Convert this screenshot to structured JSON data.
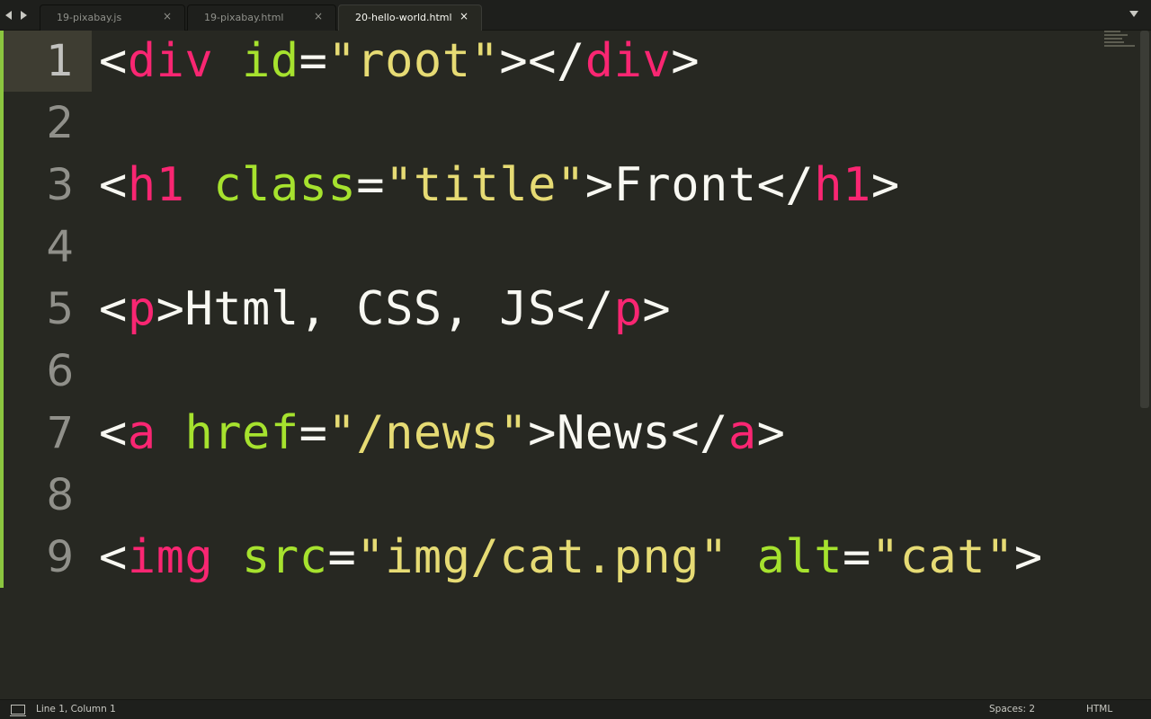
{
  "tabs": [
    {
      "label": "19-pixabay.js",
      "close": "×",
      "active": false
    },
    {
      "label": "19-pixabay.html",
      "close": "×",
      "active": false
    },
    {
      "label": "20-hello-world.html",
      "close": "×",
      "active": true
    }
  ],
  "line_numbers": [
    "1",
    "2",
    "3",
    "4",
    "5",
    "6",
    "7",
    "8",
    "9"
  ],
  "code": {
    "line1": {
      "open": "<",
      "tag": "div",
      "sp": " ",
      "attr": "id",
      "eq": "=",
      "val": "\"root\"",
      "close": ">",
      "end_open": "</",
      "end_tag": "div",
      "end_close": ">"
    },
    "line3": {
      "open": "<",
      "tag": "h1",
      "sp": " ",
      "attr": "class",
      "eq": "=",
      "val": "\"title\"",
      "close": ">",
      "text": "Front",
      "end_open": "</",
      "end_tag": "h1",
      "end_close": ">"
    },
    "line5": {
      "open": "<",
      "tag": "p",
      "close": ">",
      "text": "Html, CSS, JS",
      "end_open": "</",
      "end_tag": "p",
      "end_close": ">"
    },
    "line7": {
      "open": "<",
      "tag": "a",
      "sp": " ",
      "attr": "href",
      "eq": "=",
      "val": "\"/news\"",
      "close": ">",
      "text": "News",
      "end_open": "</",
      "end_tag": "a",
      "end_close": ">"
    },
    "line9": {
      "open": "<",
      "tag": "img",
      "sp": " ",
      "attr": "src",
      "eq": "=",
      "val": "\"img/cat.png\"",
      "sp2": " ",
      "attr2": "alt",
      "eq2": "=",
      "val2": "\"cat\"",
      "close": ">"
    }
  },
  "status": {
    "position": "Line 1, Column 1",
    "indent": "Spaces: 2",
    "syntax": "HTML"
  },
  "colors": {
    "background": "#272822",
    "tag": "#f92672",
    "attribute": "#a6e22e",
    "string": "#e6db74",
    "text": "#f8f8f2",
    "gutter_mark": "#8bc53f"
  },
  "icons": {
    "nav_back": "arrow-left-icon",
    "nav_forward": "arrow-right-icon",
    "tab_close": "close-icon",
    "tab_dropdown": "chevron-down-icon",
    "panel_toggle": "panel-icon"
  }
}
